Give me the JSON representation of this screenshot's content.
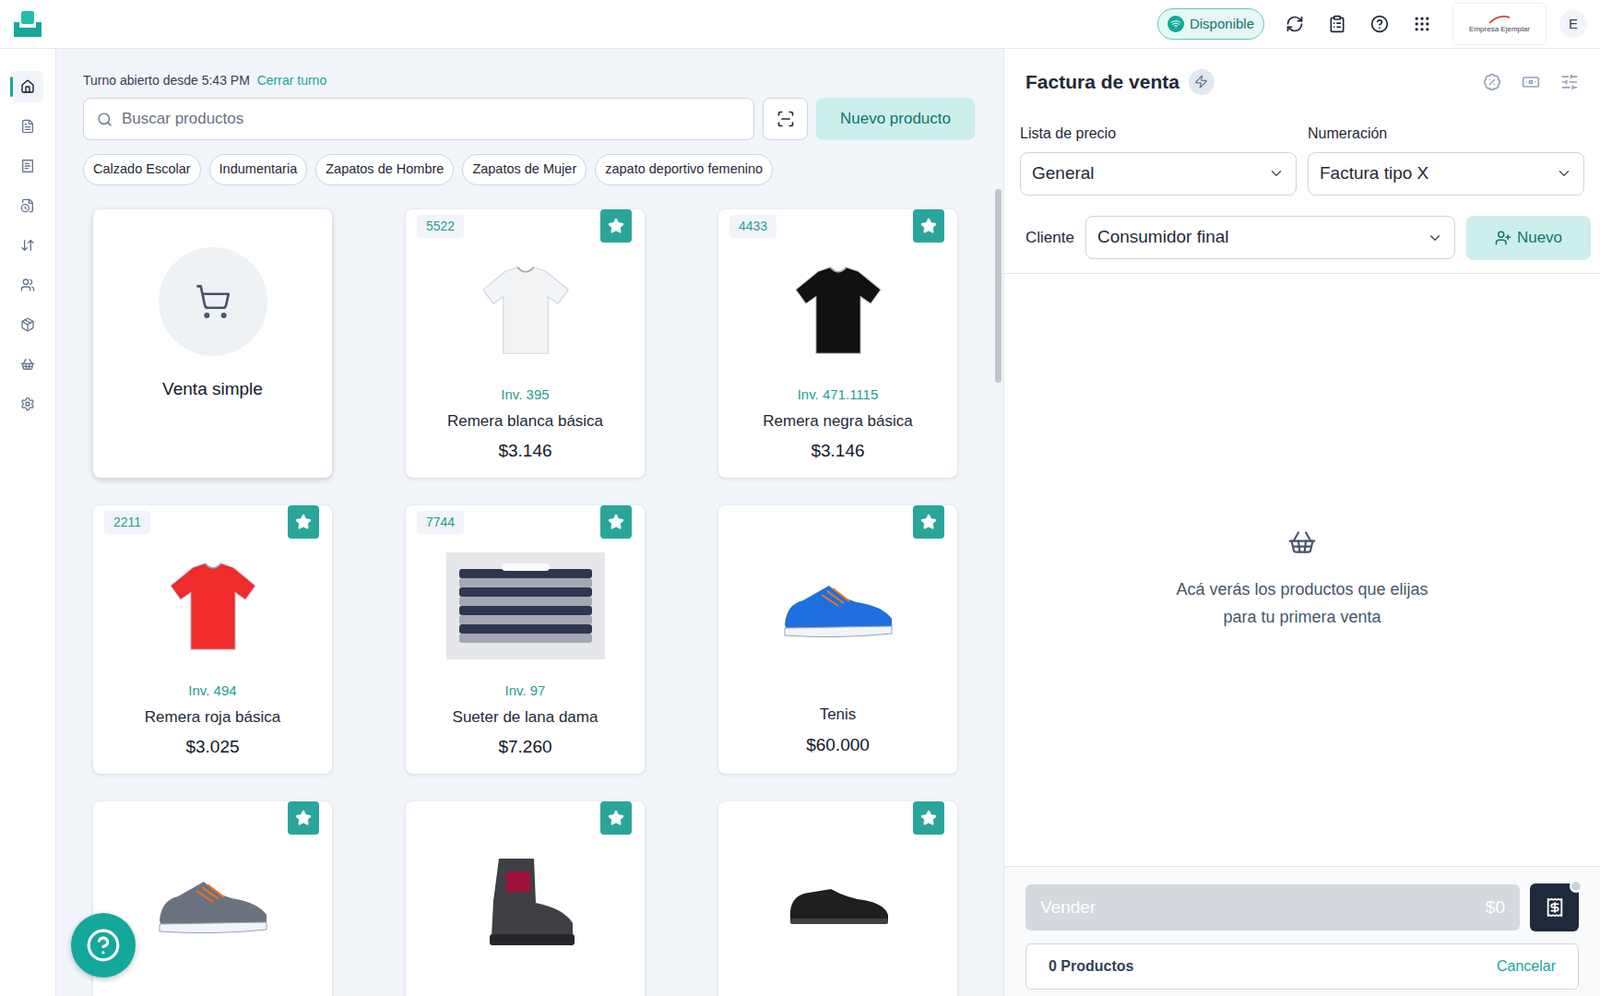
{
  "topbar": {
    "status": "Disponible",
    "company": "Empresa Ejemplar",
    "avatar": "E"
  },
  "sidebar": {
    "items": [
      {
        "selected": true
      },
      {
        "selected": false
      },
      {
        "selected": false
      },
      {
        "selected": false
      },
      {
        "selected": false
      },
      {
        "selected": false
      },
      {
        "selected": false
      },
      {
        "selected": false
      },
      {
        "selected": false
      }
    ]
  },
  "shift": {
    "text": "Turno abierto desde 5:43 PM",
    "action": "Cerrar turno"
  },
  "search": {
    "placeholder": "Buscar productos"
  },
  "new_product_button": "Nuevo producto",
  "categories": [
    "Calzado Escolar",
    "Indumentaria",
    "Zapatos de Hombre",
    "Zapatos de Mujer",
    "zapato deportivo femenino"
  ],
  "quick_sale": {
    "label": "Venta simple"
  },
  "products": [
    {
      "code": "5522",
      "inventory": "Inv. 395",
      "name": "Remera blanca básica",
      "price": "$3.146",
      "favorite": true,
      "kind": "tshirt",
      "color": "#f3f4f6"
    },
    {
      "code": "4433",
      "inventory": "Inv. 471.1115",
      "name": "Remera negra básica",
      "price": "$3.146",
      "favorite": true,
      "kind": "tshirt",
      "color": "#111111"
    },
    {
      "code": "2211",
      "inventory": "Inv. 494",
      "name": "Remera roja básica",
      "price": "$3.025",
      "favorite": true,
      "kind": "tshirt",
      "color": "#ef2b2b"
    },
    {
      "code": "7744",
      "inventory": "Inv. 97",
      "name": "Sueter de lana dama",
      "price": "$7.260",
      "favorite": true,
      "kind": "sweater",
      "color": "#2f3650"
    },
    {
      "name": "Tenis",
      "price": "$60.000",
      "favorite": true,
      "kind": "sneaker",
      "color": "#1e6fe0"
    },
    {
      "favorite": true,
      "kind": "sneaker",
      "color": "#6b7280"
    },
    {
      "favorite": true,
      "kind": "boot",
      "color": "#3f3f46"
    },
    {
      "favorite": true,
      "kind": "dress-shoe",
      "color": "#1f1f1f"
    }
  ],
  "invoice": {
    "title": "Factura de venta",
    "price_list": {
      "label": "Lista de precio",
      "value": "General"
    },
    "numbering": {
      "label": "Numeración",
      "value": "Factura tipo X"
    },
    "client": {
      "label": "Cliente",
      "value": "Consumidor final"
    },
    "new_client_button": "Nuevo",
    "empty_state": [
      "Acá verás los productos que elijas",
      "para tu primera venta"
    ],
    "sell_button": {
      "label": "Vender",
      "total": "$0",
      "disabled": true
    },
    "count": "0 Productos",
    "cancel": "Cancelar"
  }
}
